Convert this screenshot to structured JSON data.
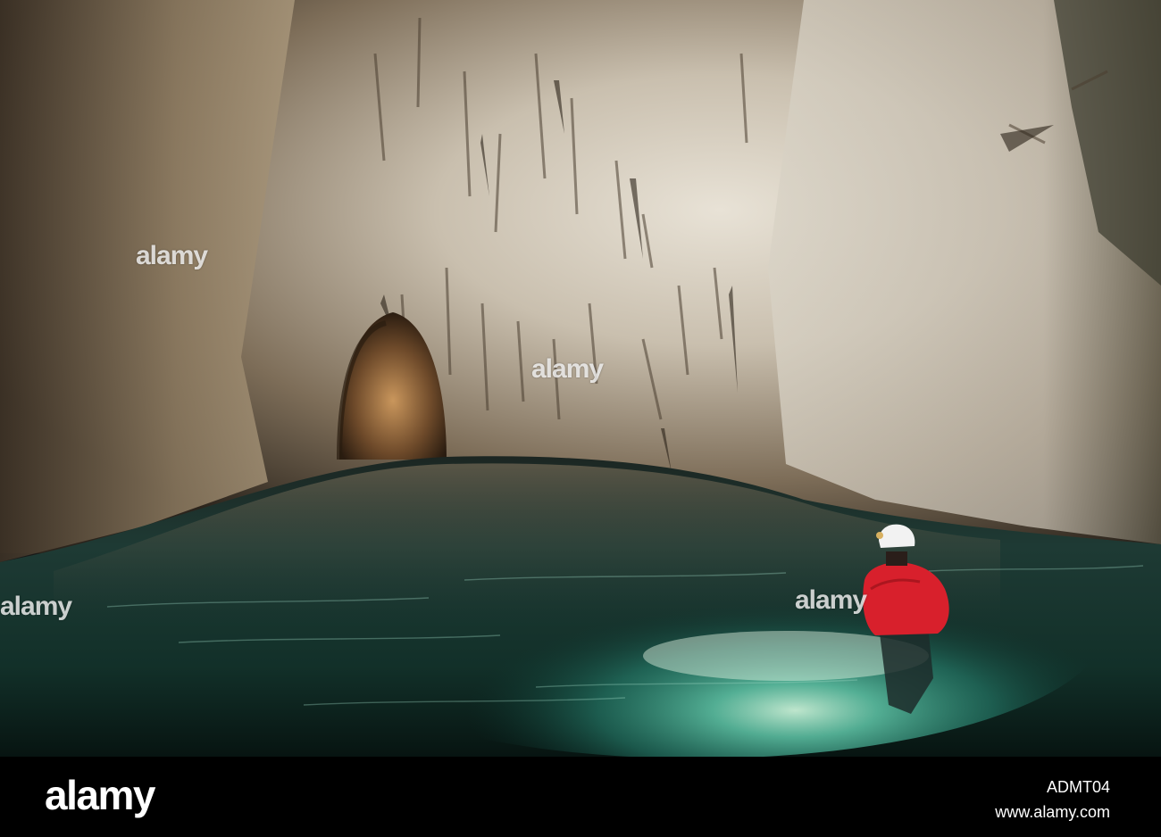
{
  "watermarks": [
    "alamy",
    "alamy",
    "alamy",
    "alamy"
  ],
  "footer": {
    "logo": "alamy",
    "image_id": "ADMT04",
    "site": "www.alamy.com"
  },
  "colors": {
    "rock_light": "#d9d0c2",
    "rock_dark": "#3a3228",
    "water_teal": "#3aa792",
    "water_dark": "#0b1a1a",
    "jacket_red": "#d8202c",
    "helmet_white": "#f2f2f2"
  }
}
